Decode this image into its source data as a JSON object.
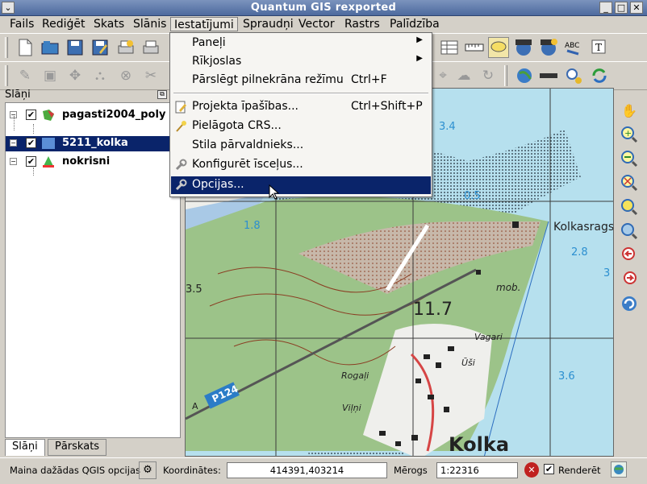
{
  "window": {
    "title": "Quantum GIS rexported",
    "menu_glyph": "⌄",
    "min_glyph": "_",
    "max_glyph": "□",
    "close_glyph": "✕"
  },
  "menubar": [
    "Fails",
    "Rediģēt",
    "Skats",
    "Slānis",
    "Iestatījumi",
    "Spraudņi",
    "Vector",
    "Rastrs",
    "Palīdzība"
  ],
  "dropdown": {
    "items": [
      {
        "label": "Paneļi",
        "shortcut": "",
        "submenu": true,
        "icon": ""
      },
      {
        "label": "Rīkjoslas",
        "shortcut": "",
        "submenu": true,
        "icon": ""
      },
      {
        "label": "Pārslēgt pilnekrāna režīmu",
        "shortcut": "Ctrl+F",
        "submenu": false,
        "icon": ""
      },
      {
        "label": "Projekta īpašības...",
        "shortcut": "Ctrl+Shift+P",
        "submenu": false,
        "icon": "project-properties-icon"
      },
      {
        "label": "Pielāgota CRS...",
        "shortcut": "",
        "submenu": false,
        "icon": "custom-crs-icon"
      },
      {
        "label": "Stila pārvaldnieks...",
        "shortcut": "",
        "submenu": false,
        "icon": ""
      },
      {
        "label": "Konfigurēt īsceļus...",
        "shortcut": "",
        "submenu": false,
        "icon": "shortcuts-icon"
      },
      {
        "label": "Opcijas...",
        "shortcut": "",
        "submenu": false,
        "icon": "options-icon",
        "highlighted": true
      }
    ],
    "submenu_arrow": "▶"
  },
  "layers_panel": {
    "title": "Slāņi",
    "float_glyph": "⧉",
    "layers": [
      {
        "name": "pagasti2004_poly",
        "checked": true,
        "selected": false
      },
      {
        "name": "5211_kolka",
        "checked": true,
        "selected": true
      },
      {
        "name": "nokrisni",
        "checked": true,
        "selected": false
      }
    ],
    "check_glyph": "✔",
    "collapse_glyph": "−",
    "tabs": [
      "Slāņi",
      "Pārskats"
    ]
  },
  "map": {
    "labels": [
      "3.4",
      "0.5",
      "1.8",
      "2.8",
      "3",
      "3.5",
      "3.6",
      "11.7",
      "Kolkasrags",
      "mob.",
      "Vagari",
      "Rogaļi",
      "Ūši",
      "Viļņi",
      "P124",
      "Kolka",
      "A"
    ],
    "colors": {
      "water": "#b6e0ee",
      "forest": "#9cc389",
      "field": "#efefec",
      "grid": "#3b3b3b",
      "contour": "#8a3d22",
      "road_red": "#d64545",
      "blue_text": "#2c8fd0"
    }
  },
  "status": {
    "message": "Maina dažādas QGIS opcijas",
    "coord_label": "Koordinātes:",
    "coord_value": "414391,403214",
    "scale_label": "Mērogs",
    "scale_value": "1:22316",
    "render_label": "Renderēt",
    "render_checked": true
  },
  "icons": {
    "toolbar1": [
      "new-project-icon",
      "open-project-icon",
      "save-project-icon",
      "save-as-icon",
      "print-composer-icon",
      "print-icon"
    ],
    "toolbar1_right": [
      "attribute-table-icon",
      "measure-icon",
      "map-tips-icon",
      "home-icon",
      "home-plus-icon",
      "spell-check-icon",
      "text-annotation-icon"
    ],
    "toolbar2": [
      "edit-pencil-icon",
      "save-edits-icon",
      "move-feature-icon",
      "node-tool-icon",
      "delete-icon",
      "cut-icon"
    ],
    "toolbar2_right": [
      "identify-icon",
      "reshape-icon",
      "rotate-icon",
      "globe-icon",
      "zoom-full-icon",
      "gps-icon",
      "refresh-icon"
    ],
    "nav": [
      "pan-hand-icon",
      "zoom-in-icon",
      "zoom-out-icon",
      "zoom-full-icon",
      "zoom-selection-icon",
      "zoom-layer-icon",
      "zoom-last-icon",
      "zoom-next-icon",
      "refresh-icon"
    ]
  }
}
